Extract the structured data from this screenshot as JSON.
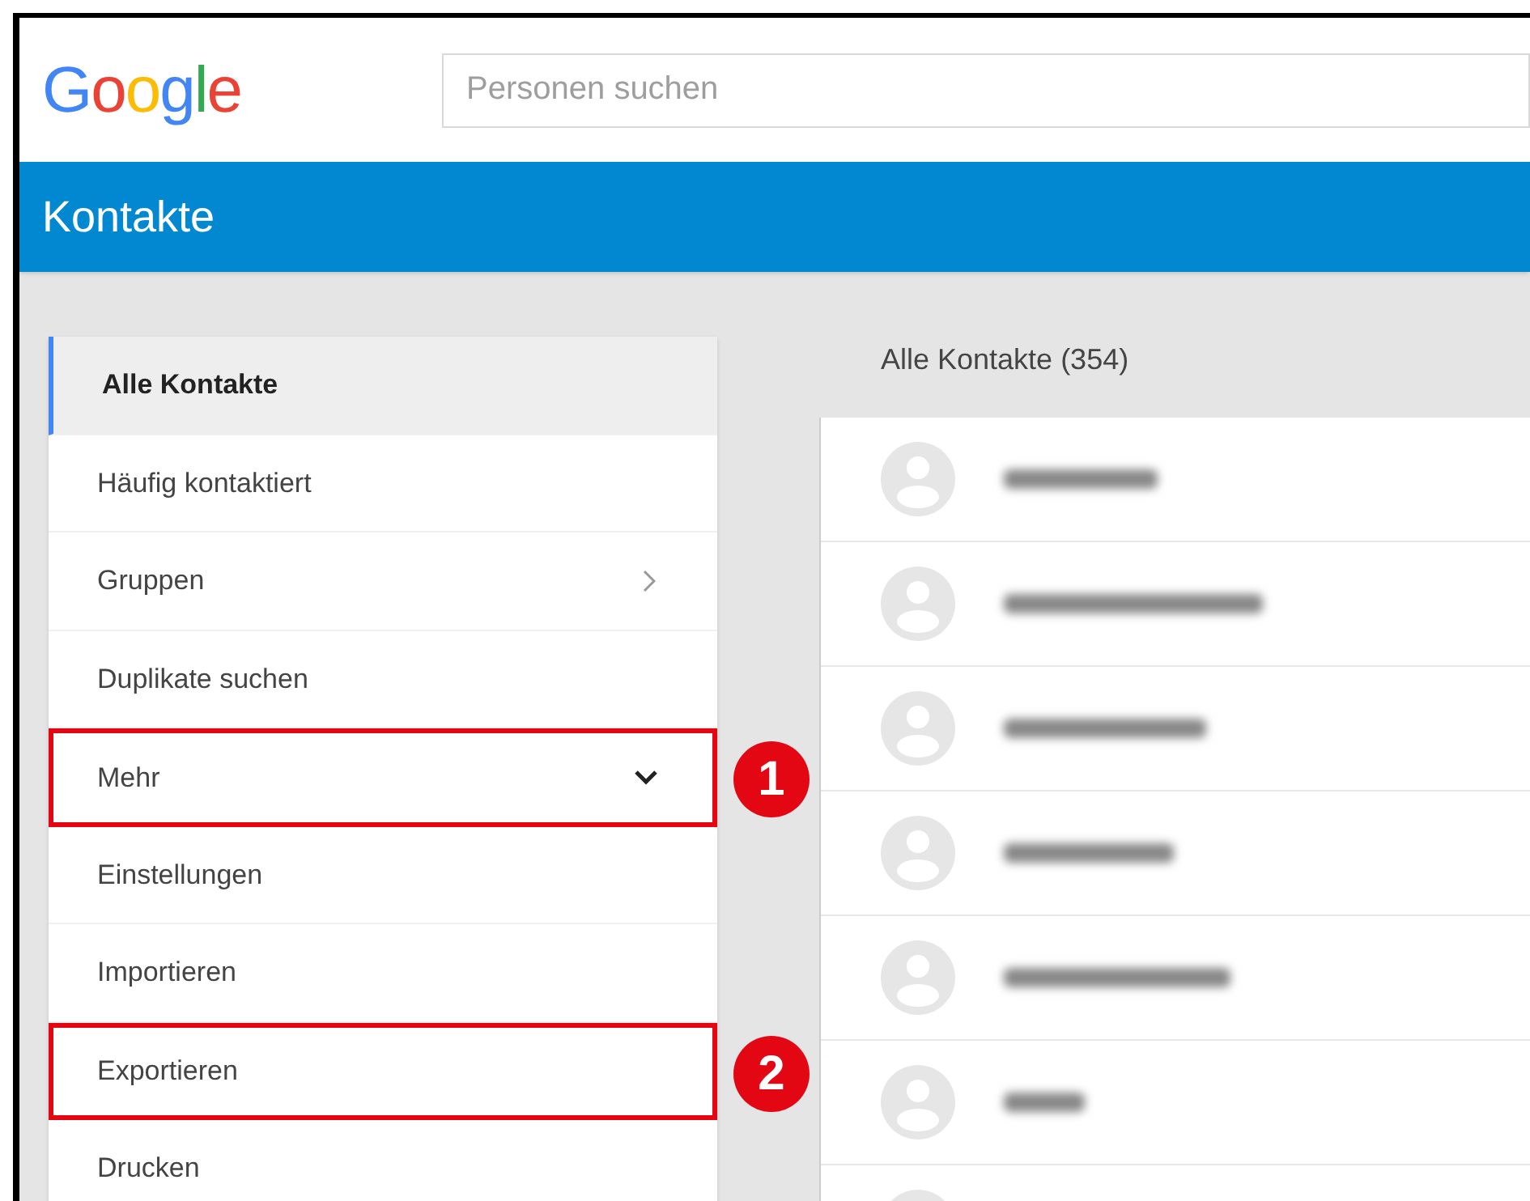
{
  "header": {
    "logo": "Google",
    "search": {
      "placeholder": "Personen suchen"
    }
  },
  "title_bar": {
    "title": "Kontakte"
  },
  "sidebar": {
    "items": [
      {
        "label": "Alle Kontakte",
        "kind": "plain",
        "selected": true,
        "highlighted": false
      },
      {
        "label": "Häufig kontaktiert",
        "kind": "plain",
        "selected": false,
        "highlighted": false
      },
      {
        "label": "Gruppen",
        "kind": "submenu",
        "selected": false,
        "highlighted": false
      },
      {
        "label": "Duplikate suchen",
        "kind": "plain",
        "selected": false,
        "highlighted": false
      },
      {
        "label": "Mehr",
        "kind": "expander",
        "selected": false,
        "highlighted": true,
        "callout": "1"
      },
      {
        "label": "Einstellungen",
        "kind": "plain",
        "selected": false,
        "highlighted": false
      },
      {
        "label": "Importieren",
        "kind": "plain",
        "selected": false,
        "highlighted": false
      },
      {
        "label": "Exportieren",
        "kind": "plain",
        "selected": false,
        "highlighted": true,
        "callout": "2"
      },
      {
        "label": "Drucken",
        "kind": "plain",
        "selected": false,
        "highlighted": false
      }
    ]
  },
  "contacts": {
    "heading": "Alle Kontakte (354)"
  }
}
